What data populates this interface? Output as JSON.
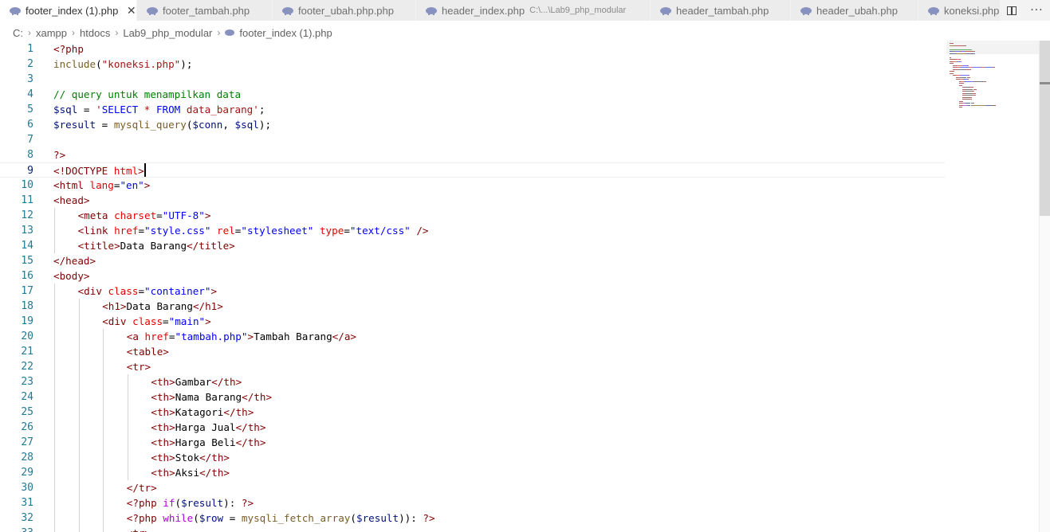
{
  "tabs": [
    {
      "label": "footer_index (1).php",
      "active": true,
      "close": "✕"
    },
    {
      "label": "footer_tambah.php"
    },
    {
      "label": "footer_ubah.php.php"
    },
    {
      "label": "header_index.php",
      "description": "C:\\...\\Lab9_php_modular"
    },
    {
      "label": "header_tambah.php"
    },
    {
      "label": "header_ubah.php"
    },
    {
      "label": "koneksi.php"
    }
  ],
  "tab_actions": {
    "more": "···"
  },
  "breadcrumb": [
    "C:",
    "xampp",
    "htdocs",
    "Lab9_php_modular",
    "footer_index (1).php"
  ],
  "breadcrumb_separator": "›",
  "colors": {
    "line_number": "#237893",
    "html_tag": "#800000",
    "html_attr": "#e50000",
    "string": "#0000ff",
    "comment": "#008000",
    "keyword": "#af00db",
    "variable": "#001080",
    "function": "#795e26"
  },
  "editor": {
    "current_line": 9,
    "lines": [
      {
        "n": "1",
        "indent": 0,
        "tokens": [
          [
            "t-php",
            "<?php"
          ]
        ]
      },
      {
        "n": "2",
        "indent": 0,
        "tokens": [
          [
            "t-fn",
            "include"
          ],
          [
            "t-text",
            "("
          ],
          [
            "t-sqlstr",
            "\"koneksi.php\""
          ],
          [
            "t-text",
            ");"
          ]
        ]
      },
      {
        "n": "3",
        "indent": 0,
        "tokens": []
      },
      {
        "n": "4",
        "indent": 0,
        "tokens": [
          [
            "t-comment",
            "// query untuk menampilkan data"
          ]
        ]
      },
      {
        "n": "5",
        "indent": 0,
        "tokens": [
          [
            "t-var",
            "$sql"
          ],
          [
            "t-text",
            " = "
          ],
          [
            "t-sqlstr",
            "'"
          ],
          [
            "t-sqlkw",
            "SELECT"
          ],
          [
            "t-sqlstr",
            " * "
          ],
          [
            "t-sqlkw",
            "FROM"
          ],
          [
            "t-sqlstr",
            " data_barang'"
          ],
          [
            "t-text",
            ";"
          ]
        ]
      },
      {
        "n": "6",
        "indent": 0,
        "tokens": [
          [
            "t-var",
            "$result"
          ],
          [
            "t-text",
            " = "
          ],
          [
            "t-fn",
            "mysqli_query"
          ],
          [
            "t-text",
            "("
          ],
          [
            "t-var",
            "$conn"
          ],
          [
            "t-text",
            ", "
          ],
          [
            "t-var",
            "$sql"
          ],
          [
            "t-text",
            ");"
          ]
        ]
      },
      {
        "n": "7",
        "indent": 0,
        "tokens": []
      },
      {
        "n": "8",
        "indent": 0,
        "tokens": [
          [
            "t-php",
            "?>"
          ]
        ]
      },
      {
        "n": "9",
        "indent": 0,
        "tokens": [
          [
            "t-tag",
            "<!DOCTYPE "
          ],
          [
            "t-attr",
            "html"
          ],
          [
            "t-tag",
            ">"
          ]
        ]
      },
      {
        "n": "10",
        "indent": 0,
        "tokens": [
          [
            "t-tag",
            "<html "
          ],
          [
            "t-attr",
            "lang"
          ],
          [
            "t-text",
            "="
          ],
          [
            "t-str",
            "\"en\""
          ],
          [
            "t-tag",
            ">"
          ]
        ]
      },
      {
        "n": "11",
        "indent": 0,
        "tokens": [
          [
            "t-tag",
            "<head>"
          ]
        ]
      },
      {
        "n": "12",
        "indent": 1,
        "tokens": [
          [
            "t-tag",
            "<meta "
          ],
          [
            "t-attr",
            "charset"
          ],
          [
            "t-text",
            "="
          ],
          [
            "t-str",
            "\"UTF-8\""
          ],
          [
            "t-tag",
            ">"
          ]
        ]
      },
      {
        "n": "13",
        "indent": 1,
        "tokens": [
          [
            "t-tag",
            "<link "
          ],
          [
            "t-attr",
            "href"
          ],
          [
            "t-text",
            "="
          ],
          [
            "t-str",
            "\"style.css\""
          ],
          [
            "t-text",
            " "
          ],
          [
            "t-attr",
            "rel"
          ],
          [
            "t-text",
            "="
          ],
          [
            "t-str",
            "\"stylesheet\""
          ],
          [
            "t-text",
            " "
          ],
          [
            "t-attr",
            "type"
          ],
          [
            "t-text",
            "="
          ],
          [
            "t-str",
            "\"text/css\""
          ],
          [
            "t-text",
            " "
          ],
          [
            "t-tag",
            "/>"
          ]
        ]
      },
      {
        "n": "14",
        "indent": 1,
        "tokens": [
          [
            "t-tag",
            "<title>"
          ],
          [
            "t-text",
            "Data Barang"
          ],
          [
            "t-tag",
            "</title>"
          ]
        ]
      },
      {
        "n": "15",
        "indent": 0,
        "tokens": [
          [
            "t-tag",
            "</head>"
          ]
        ]
      },
      {
        "n": "16",
        "indent": 0,
        "tokens": [
          [
            "t-tag",
            "<body>"
          ]
        ]
      },
      {
        "n": "17",
        "indent": 1,
        "tokens": [
          [
            "t-tag",
            "<div "
          ],
          [
            "t-attr",
            "class"
          ],
          [
            "t-text",
            "="
          ],
          [
            "t-str",
            "\"container\""
          ],
          [
            "t-tag",
            ">"
          ]
        ]
      },
      {
        "n": "18",
        "indent": 2,
        "tokens": [
          [
            "t-tag",
            "<h1>"
          ],
          [
            "t-text",
            "Data Barang"
          ],
          [
            "t-tag",
            "</h1>"
          ]
        ]
      },
      {
        "n": "19",
        "indent": 2,
        "tokens": [
          [
            "t-tag",
            "<div "
          ],
          [
            "t-attr",
            "class"
          ],
          [
            "t-text",
            "="
          ],
          [
            "t-str",
            "\"main\""
          ],
          [
            "t-tag",
            ">"
          ]
        ]
      },
      {
        "n": "20",
        "indent": 3,
        "tokens": [
          [
            "t-tag",
            "<a "
          ],
          [
            "t-attr",
            "href"
          ],
          [
            "t-text",
            "="
          ],
          [
            "t-str",
            "\"tambah.php\""
          ],
          [
            "t-tag",
            ">"
          ],
          [
            "t-text",
            "Tambah Barang"
          ],
          [
            "t-tag",
            "</a>"
          ]
        ]
      },
      {
        "n": "21",
        "indent": 3,
        "tokens": [
          [
            "t-tag",
            "<table>"
          ]
        ]
      },
      {
        "n": "22",
        "indent": 3,
        "tokens": [
          [
            "t-tag",
            "<tr>"
          ]
        ]
      },
      {
        "n": "23",
        "indent": 4,
        "tokens": [
          [
            "t-tag",
            "<th>"
          ],
          [
            "t-text",
            "Gambar"
          ],
          [
            "t-tag",
            "</th>"
          ]
        ]
      },
      {
        "n": "24",
        "indent": 4,
        "tokens": [
          [
            "t-tag",
            "<th>"
          ],
          [
            "t-text",
            "Nama Barang"
          ],
          [
            "t-tag",
            "</th>"
          ]
        ]
      },
      {
        "n": "25",
        "indent": 4,
        "tokens": [
          [
            "t-tag",
            "<th>"
          ],
          [
            "t-text",
            "Katagori"
          ],
          [
            "t-tag",
            "</th>"
          ]
        ]
      },
      {
        "n": "26",
        "indent": 4,
        "tokens": [
          [
            "t-tag",
            "<th>"
          ],
          [
            "t-text",
            "Harga Jual"
          ],
          [
            "t-tag",
            "</th>"
          ]
        ]
      },
      {
        "n": "27",
        "indent": 4,
        "tokens": [
          [
            "t-tag",
            "<th>"
          ],
          [
            "t-text",
            "Harga Beli"
          ],
          [
            "t-tag",
            "</th>"
          ]
        ]
      },
      {
        "n": "28",
        "indent": 4,
        "tokens": [
          [
            "t-tag",
            "<th>"
          ],
          [
            "t-text",
            "Stok"
          ],
          [
            "t-tag",
            "</th>"
          ]
        ]
      },
      {
        "n": "29",
        "indent": 4,
        "tokens": [
          [
            "t-tag",
            "<th>"
          ],
          [
            "t-text",
            "Aksi"
          ],
          [
            "t-tag",
            "</th>"
          ]
        ]
      },
      {
        "n": "30",
        "indent": 3,
        "tokens": [
          [
            "t-tag",
            "</tr>"
          ]
        ]
      },
      {
        "n": "31",
        "indent": 3,
        "tokens": [
          [
            "t-php",
            "<?php "
          ],
          [
            "t-kw",
            "if"
          ],
          [
            "t-text",
            "("
          ],
          [
            "t-var",
            "$result"
          ],
          [
            "t-text",
            "): "
          ],
          [
            "t-php",
            "?>"
          ]
        ]
      },
      {
        "n": "32",
        "indent": 3,
        "tokens": [
          [
            "t-php",
            "<?php "
          ],
          [
            "t-kw",
            "while"
          ],
          [
            "t-text",
            "("
          ],
          [
            "t-var",
            "$row"
          ],
          [
            "t-text",
            " = "
          ],
          [
            "t-fn",
            "mysqli_fetch_array"
          ],
          [
            "t-text",
            "("
          ],
          [
            "t-var",
            "$result"
          ],
          [
            "t-text",
            ")): "
          ],
          [
            "t-php",
            "?>"
          ]
        ]
      },
      {
        "n": "33",
        "indent": 3,
        "tokens": [
          [
            "t-tag",
            "<tr>"
          ]
        ]
      }
    ]
  }
}
